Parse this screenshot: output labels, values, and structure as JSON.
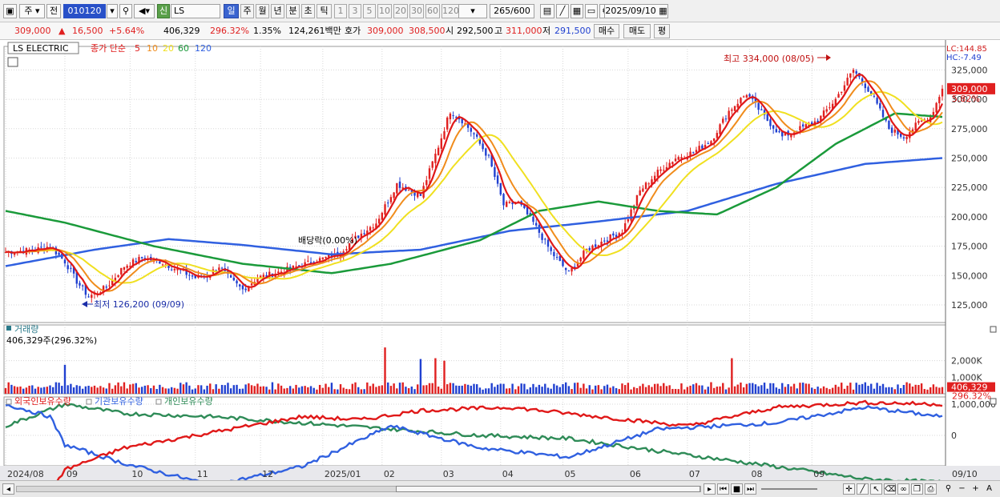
{
  "toolbar": {
    "market_select": "주",
    "prev_label": "전",
    "code": "010120",
    "name": "LS ELECTR",
    "sin_label": "신",
    "periods": [
      "일",
      "주",
      "월",
      "년",
      "분",
      "초",
      "틱"
    ],
    "minutes": [
      "1",
      "3",
      "5",
      "10",
      "20",
      "30",
      "60",
      "120"
    ],
    "count": "265",
    "count_total": "/600",
    "date": "2025/09/10"
  },
  "quote": {
    "price": "309,000",
    "change": "16,500",
    "change_pct": "+5.64%",
    "volume": "406,329",
    "volume_ratio": "296.32%",
    "turnover": "1.35%",
    "amount": "124,261백만",
    "ask_label": "호가",
    "ask": "309,000",
    "bid": "308,500",
    "open_label": "시",
    "open": "292,500",
    "high_label": "고",
    "high": "311,000",
    "low_label": "저",
    "low": "291,500",
    "buy_label": "매수",
    "sell_label": "매도",
    "eval_label": "평"
  },
  "colors": {
    "up": "#e02020",
    "down": "#2040d0",
    "ma5": "#e01818",
    "ma10": "#f08c1c",
    "ma20": "#f0e020",
    "ma60": "#1a9a3a",
    "ma120": "#3060e0",
    "foreign": "#e01818",
    "institution": "#3060e0",
    "individual": "#2e8b57"
  },
  "chart_data": [
    {
      "type": "candlestick",
      "title": "LS ELECTRIC",
      "legend": [
        "종가 단순",
        "5",
        "10",
        "20",
        "60",
        "120"
      ],
      "yticks": [
        125000,
        150000,
        175000,
        200000,
        225000,
        250000,
        275000,
        300000,
        325000
      ],
      "ytick_labels": [
        "125,000",
        "150,000",
        "175,000",
        "200,000",
        "225,000",
        "250,000",
        "275,000",
        "300,000",
        "325,000"
      ],
      "ylim": [
        110000,
        345000
      ],
      "lc_label": "LC:144.85",
      "hc_label": "HC:-7.49",
      "current_price_label": "309,000",
      "current_pct_label": "5.82%",
      "annotations": {
        "high": "최고 334,000 (08/05)",
        "low": "최저 126,200 (09/09)",
        "dividend": "배당락(0.00%)"
      },
      "close_keypoints": [
        [
          0,
          170000
        ],
        [
          10,
          172000
        ],
        [
          15,
          175000
        ],
        [
          20,
          162000
        ],
        [
          24,
          145000
        ],
        [
          28,
          132000
        ],
        [
          34,
          140000
        ],
        [
          40,
          158000
        ],
        [
          46,
          165000
        ],
        [
          52,
          162000
        ],
        [
          58,
          155000
        ],
        [
          64,
          148000
        ],
        [
          68,
          150000
        ],
        [
          72,
          158000
        ],
        [
          76,
          146000
        ],
        [
          80,
          138000
        ],
        [
          85,
          148000
        ],
        [
          95,
          155000
        ],
        [
          105,
          163000
        ],
        [
          112,
          168000
        ],
        [
          118,
          182000
        ],
        [
          125,
          195000
        ],
        [
          132,
          228000
        ],
        [
          140,
          218000
        ],
        [
          146,
          260000
        ],
        [
          150,
          290000
        ],
        [
          154,
          282000
        ],
        [
          158,
          270000
        ],
        [
          163,
          250000
        ],
        [
          168,
          210000
        ],
        [
          173,
          212000
        ],
        [
          178,
          195000
        ],
        [
          184,
          170000
        ],
        [
          190,
          152000
        ],
        [
          196,
          172000
        ],
        [
          202,
          180000
        ],
        [
          208,
          188000
        ],
        [
          214,
          222000
        ],
        [
          220,
          238000
        ],
        [
          226,
          250000
        ],
        [
          232,
          255000
        ],
        [
          238,
          265000
        ],
        [
          244,
          290000
        ],
        [
          250,
          305000
        ],
        [
          256,
          285000
        ],
        [
          262,
          268000
        ],
        [
          268,
          275000
        ],
        [
          274,
          282000
        ],
        [
          280,
          300000
        ],
        [
          286,
          325000
        ],
        [
          292,
          305000
        ],
        [
          298,
          275000
        ],
        [
          303,
          268000
        ],
        [
          308,
          280000
        ],
        [
          312,
          285000
        ],
        [
          316,
          309000
        ]
      ],
      "ma60_keypoints": [
        [
          0,
          205000
        ],
        [
          20,
          195000
        ],
        [
          50,
          175000
        ],
        [
          80,
          160000
        ],
        [
          110,
          152000
        ],
        [
          130,
          160000
        ],
        [
          160,
          180000
        ],
        [
          180,
          205000
        ],
        [
          200,
          213000
        ],
        [
          220,
          205000
        ],
        [
          240,
          202000
        ],
        [
          260,
          225000
        ],
        [
          280,
          262000
        ],
        [
          300,
          288000
        ],
        [
          316,
          285000
        ]
      ],
      "ma120_keypoints": [
        [
          0,
          158000
        ],
        [
          30,
          172000
        ],
        [
          55,
          181000
        ],
        [
          80,
          176000
        ],
        [
          110,
          168000
        ],
        [
          140,
          172000
        ],
        [
          170,
          188000
        ],
        [
          200,
          196000
        ],
        [
          230,
          205000
        ],
        [
          260,
          228000
        ],
        [
          290,
          245000
        ],
        [
          316,
          250000
        ]
      ]
    },
    {
      "type": "bar",
      "title": "거래량",
      "value_label": "406,329주(296.32%)",
      "yticks_labels": [
        "1,000K",
        "2,000K"
      ],
      "last_volume_label": "406,329",
      "last_pct_label": "296.32%",
      "spikes": [
        [
          20,
          1750000
        ],
        [
          128,
          2800000
        ],
        [
          140,
          2100000
        ],
        [
          145,
          2150000
        ],
        [
          148,
          2000000
        ],
        [
          245,
          2150000
        ]
      ]
    },
    {
      "type": "line",
      "legend": [
        "외국인보유수량",
        "기관보유수량",
        "개인보유수량"
      ],
      "yticks_labels": [
        "1,000,000",
        "0"
      ],
      "foreign_keypoints": [
        [
          0,
          -2.1
        ],
        [
          12,
          -2.2
        ],
        [
          20,
          -1.1
        ],
        [
          40,
          -0.4
        ],
        [
          70,
          0.1
        ],
        [
          100,
          0.6
        ],
        [
          120,
          0.5
        ],
        [
          140,
          0.8
        ],
        [
          170,
          0.9
        ],
        [
          200,
          0.6
        ],
        [
          230,
          0.3
        ],
        [
          260,
          0.9
        ],
        [
          290,
          1.05
        ],
        [
          316,
          1.0
        ]
      ],
      "institution_keypoints": [
        [
          0,
          1.0
        ],
        [
          15,
          0.6
        ],
        [
          20,
          -0.3
        ],
        [
          40,
          -0.9
        ],
        [
          70,
          -1.6
        ],
        [
          100,
          -1.0
        ],
        [
          130,
          0.3
        ],
        [
          160,
          -0.4
        ],
        [
          190,
          -0.7
        ],
        [
          220,
          0.2
        ],
        [
          260,
          0.4
        ],
        [
          290,
          0.9
        ],
        [
          316,
          0.6
        ]
      ],
      "individual_keypoints": [
        [
          0,
          0.3
        ],
        [
          20,
          1.0
        ],
        [
          40,
          0.7
        ],
        [
          70,
          0.6
        ],
        [
          100,
          0.4
        ],
        [
          130,
          0.2
        ],
        [
          160,
          0.0
        ],
        [
          190,
          -0.1
        ],
        [
          220,
          -0.5
        ],
        [
          260,
          -1.0
        ],
        [
          290,
          -1.4
        ],
        [
          316,
          -1.5
        ]
      ]
    }
  ],
  "xaxis": {
    "labels": [
      "2024/08",
      "09",
      "10",
      "11",
      "12",
      "2025/01",
      "02",
      "03",
      "04",
      "05",
      "06",
      "07",
      "08",
      "09"
    ],
    "right_label": "09/10"
  }
}
